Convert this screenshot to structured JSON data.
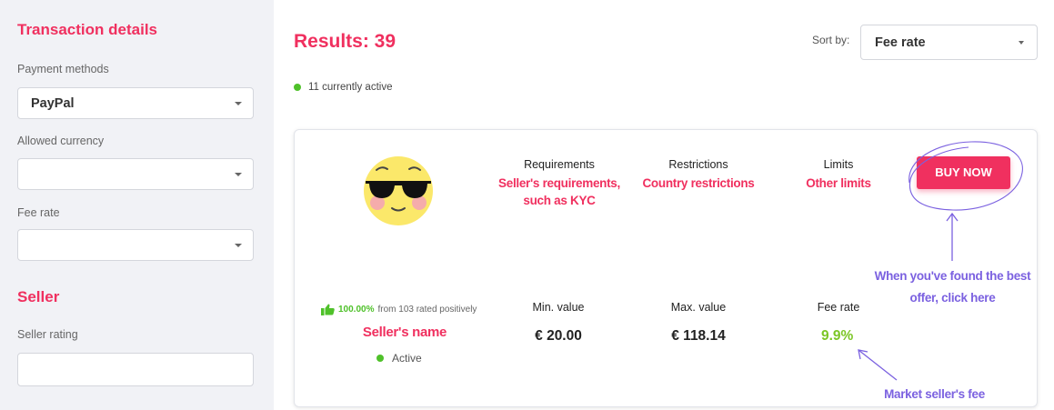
{
  "sidebar": {
    "transaction_heading": "Transaction details",
    "payment_label": "Payment methods",
    "payment_value": "PayPal",
    "currency_label": "Allowed currency",
    "currency_value": "",
    "feerate_label": "Fee rate",
    "feerate_value": "",
    "seller_heading": "Seller",
    "seller_rating_label": "Seller rating",
    "seller_rating_value": ""
  },
  "main": {
    "results_title": "Results: 39",
    "active_count": "11 currently active",
    "sort_label": "Sort by:",
    "sort_value": "Fee rate"
  },
  "offer": {
    "requirements_label": "Requirements",
    "requirements_note_1": "Seller's requirements,",
    "requirements_note_2": "such as KYC",
    "restrictions_label": "Restrictions",
    "restrictions_note": "Country restrictions",
    "limits_label": "Limits",
    "limits_note": "Other limits",
    "buy_button": "BUY NOW",
    "rating_pct": "100.00%",
    "rating_text": "from 103 rated positively",
    "seller_name": "Seller's name",
    "status": "Active",
    "min_label": "Min. value",
    "min_value": "€ 20.00",
    "max_label": "Max. value",
    "max_value": "€ 118.14",
    "fee_label": "Fee rate",
    "fee_value": "9.9%"
  },
  "annotations": {
    "best_offer_1": "When you've found the best",
    "best_offer_2": "offer, click here",
    "market_fee": "Market seller's fee"
  },
  "colors": {
    "accent_pink": "#f0305f",
    "annotation_purple": "#7b61e0",
    "status_green": "#4fc12a",
    "fee_green": "#7cc626",
    "sidebar_bg": "#f1f2f6"
  },
  "icons": [
    "sunglasses-emoji-avatar",
    "thumbs-up-icon",
    "chevron-down-icon",
    "status-dot"
  ]
}
